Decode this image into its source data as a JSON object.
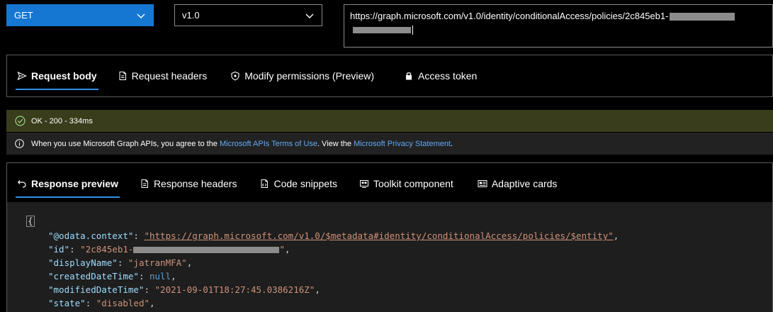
{
  "request": {
    "method": "GET",
    "version": "v1.0",
    "url_visible": "https://graph.microsoft.com/v1.0/identity/conditionalAccess/policies/2c845eb1-"
  },
  "request_tabs": [
    {
      "label": "Request body",
      "icon": "send-icon",
      "active": true
    },
    {
      "label": "Request headers",
      "icon": "document-icon",
      "active": false
    },
    {
      "label": "Modify permissions (Preview)",
      "icon": "shield-icon",
      "active": false
    },
    {
      "label": "Access token",
      "icon": "lock-icon",
      "active": false
    }
  ],
  "status": {
    "text": "OK - 200 - 334ms",
    "color": "#393d1b"
  },
  "info": {
    "prefix": "When you use Microsoft Graph APIs, you agree to the ",
    "terms_link": "Microsoft APIs Terms of Use",
    "middle": ". View the ",
    "privacy_link": "Microsoft Privacy Statement",
    "suffix": "."
  },
  "response_tabs": [
    {
      "label": "Response preview",
      "icon": "undo-icon",
      "active": true
    },
    {
      "label": "Response headers",
      "icon": "document-icon",
      "active": false
    },
    {
      "label": "Code snippets",
      "icon": "code-file-icon",
      "active": false
    },
    {
      "label": "Toolkit component",
      "icon": "toolkit-icon",
      "active": false
    },
    {
      "label": "Adaptive cards",
      "icon": "card-icon",
      "active": false
    }
  ],
  "response_json": {
    "open_brace": "{",
    "lines": [
      {
        "key": "\"@odata.context\"",
        "value": "\"https://graph.microsoft.com/v1.0/$metadata#identity/conditionalAccess/policies/$entity\"",
        "kind": "url"
      },
      {
        "key": "\"id\"",
        "value": "\"2c845eb1-",
        "value_end": "\"",
        "kind": "redacted"
      },
      {
        "key": "\"displayName\"",
        "value": "\"jatranMFA\"",
        "kind": "string"
      },
      {
        "key": "\"createdDateTime\"",
        "value": "null",
        "kind": "null"
      },
      {
        "key": "\"modifiedDateTime\"",
        "value": "\"2021-09-01T18:27:45.0386216Z\"",
        "kind": "string"
      },
      {
        "key": "\"state\"",
        "value": "\"disabled\"",
        "kind": "string"
      }
    ]
  },
  "colors": {
    "accent": "#1677d3",
    "tab_underline": "#2f8fe8",
    "link": "#62a9f5",
    "json_key": "#9cdcfe",
    "json_string": "#ce9178",
    "json_null": "#569cd6"
  }
}
